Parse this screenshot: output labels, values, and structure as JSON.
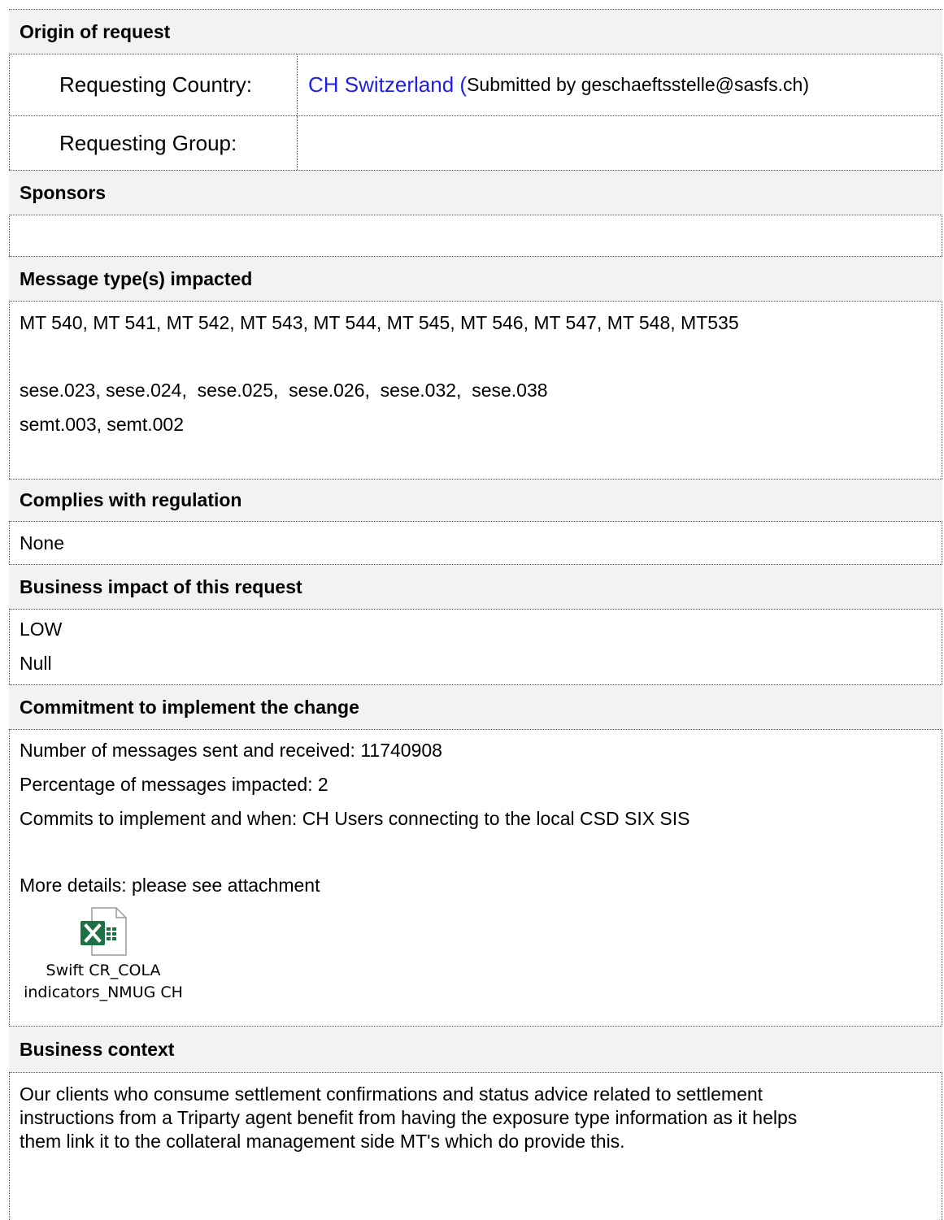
{
  "origin": {
    "header": "Origin of request",
    "requesting_country_label": "Requesting Country:",
    "requesting_country_value": "CH Switzerland (",
    "submitted_by": "Submitted by geschaeftsstelle@sasfs.ch)",
    "requesting_group_label": "Requesting Group:",
    "requesting_group_value": ""
  },
  "sponsors": {
    "header": "Sponsors",
    "value": ""
  },
  "message_types": {
    "header": "Message type(s) impacted",
    "line1": "MT 540, MT 541, MT 542, MT 543, MT 544, MT 545, MT 546, MT 547, MT 548, MT535",
    "line2": "sese.023, sese.024,  sese.025,  sese.026,  sese.032,  sese.038",
    "line3": "semt.003, semt.002"
  },
  "regulation": {
    "header": "Complies with regulation",
    "value": "None"
  },
  "business_impact": {
    "header": "Business impact of this request",
    "line1": "LOW",
    "line2": "Null"
  },
  "commitment": {
    "header": "Commitment to implement the change",
    "messages": "Number of messages sent and received: 11740908",
    "percentage": "Percentage of messages impacted: 2",
    "commits": "Commits to implement and when: CH Users connecting to the local CSD SIX SIS",
    "details": "More details: please see attachment",
    "attachment_line1": "Swift CR_COLA",
    "attachment_line2": "indicators_NMUG CH",
    "attachment_icon": "excel-file-icon",
    "excel_green": "#1e7145"
  },
  "business_context": {
    "header": "Business context",
    "line1": "Our clients who consume settlement confirmations and status advice related to settlement",
    "line2": "instructions from a Triparty agent benefit from having the exposure type information as it helps",
    "line3": "them link it to the collateral management side MT's which do provide this."
  },
  "colors": {
    "header_bg": "#f2f2f2",
    "link": "#1f1fe6",
    "border": "#555555"
  }
}
